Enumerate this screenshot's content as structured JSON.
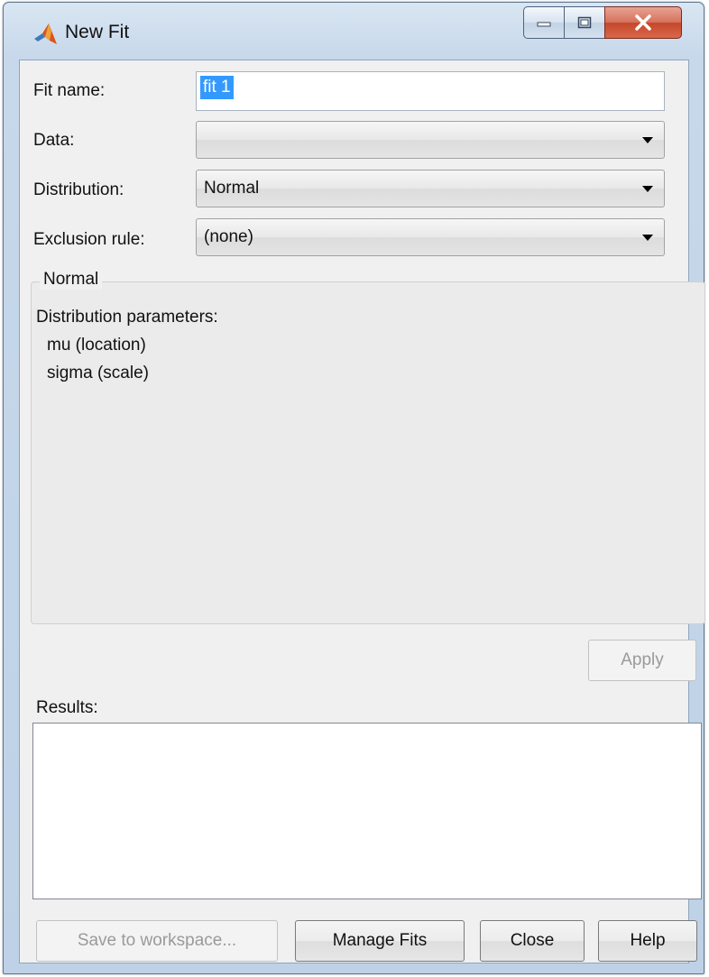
{
  "window": {
    "title": "New Fit",
    "app_icon": "matlab-logo-icon",
    "controls": [
      "minimize-icon",
      "maximize-icon",
      "close-icon"
    ]
  },
  "form": {
    "fit_name_label": "Fit name:",
    "fit_name_value": "fit 1",
    "data_label": "Data:",
    "data_value": "",
    "distribution_label": "Distribution:",
    "distribution_value": "Normal",
    "exclusion_label": "Exclusion rule:",
    "exclusion_value": "(none)"
  },
  "group": {
    "title": "Normal",
    "params_heading": "Distribution parameters:",
    "params": [
      "mu (location)",
      "sigma (scale)"
    ]
  },
  "apply_label": "Apply",
  "results_label": "Results:",
  "results_text": "",
  "buttons": {
    "save": "Save to workspace...",
    "manage": "Manage Fits",
    "close": "Close",
    "help": "Help"
  },
  "colors": {
    "selection": "#3399ff",
    "close_button": "#c4472b",
    "matlab_logo": "#d9541e"
  }
}
